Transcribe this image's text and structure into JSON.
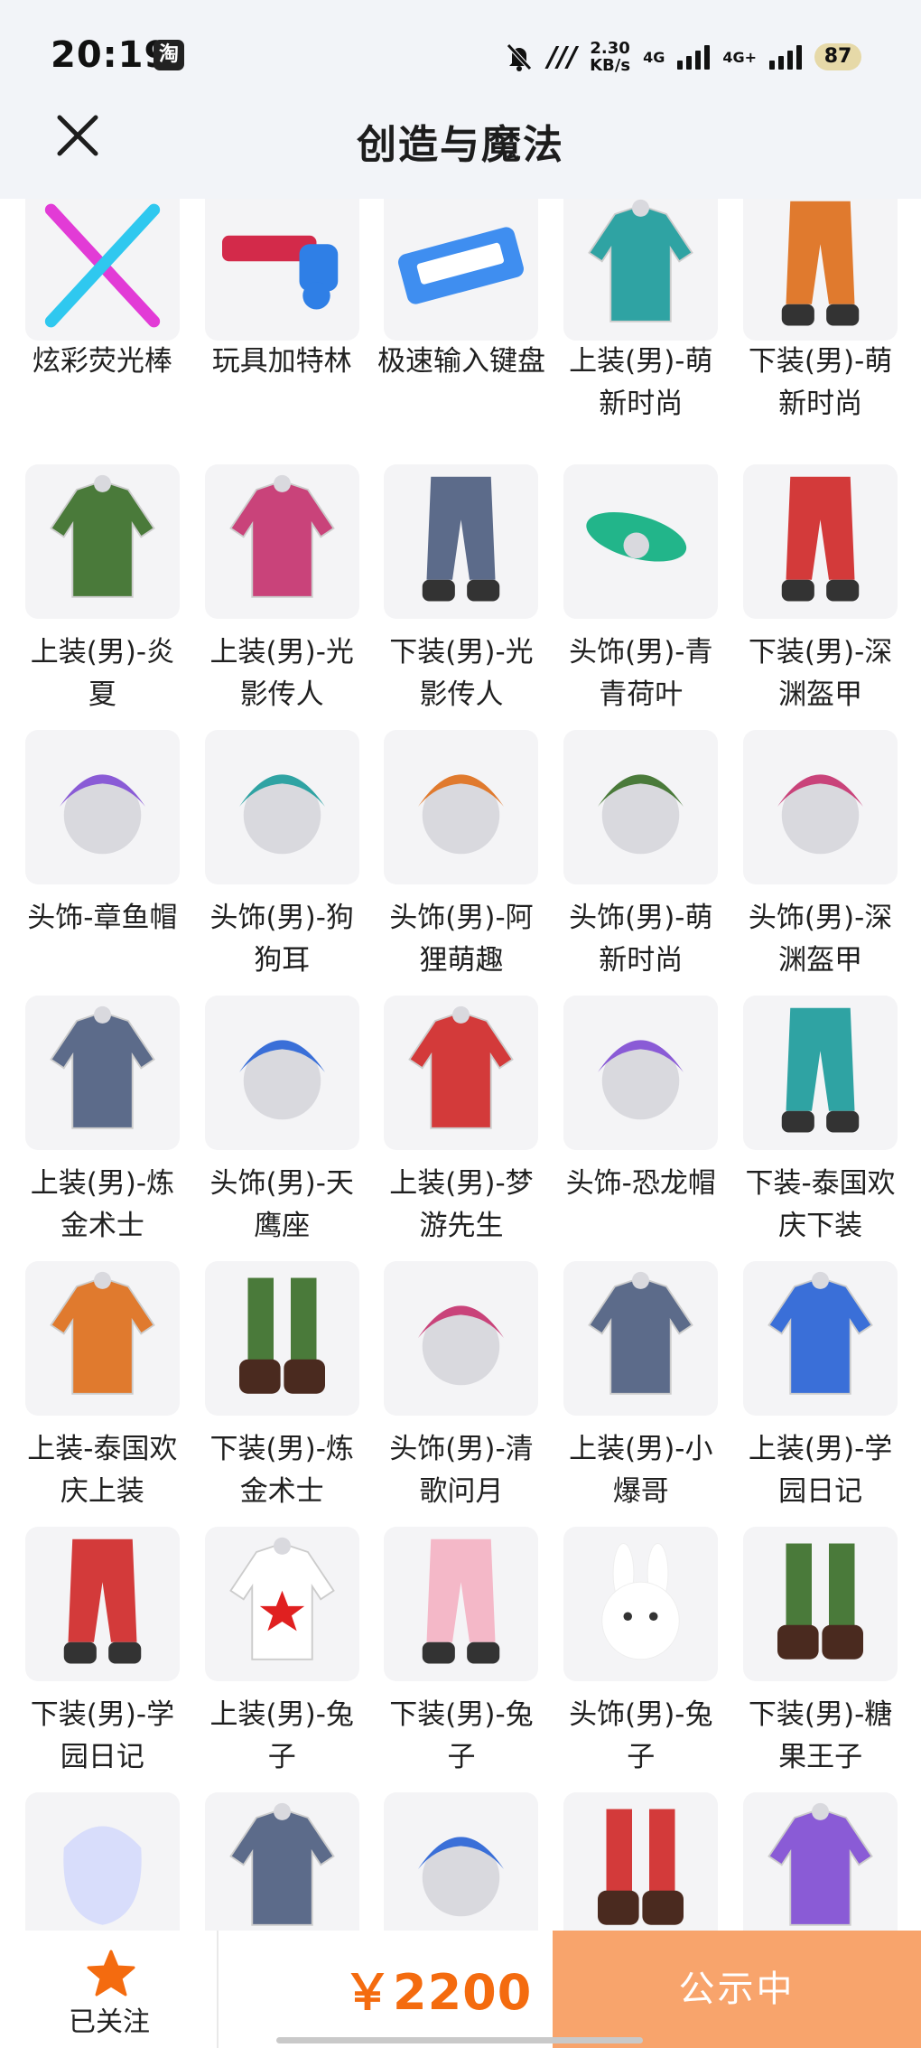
{
  "status_bar": {
    "time": "20:19",
    "app_badge": "淘",
    "speed_value": "2.30",
    "speed_unit": "KB/s",
    "net1": "4G",
    "net2": "4G+",
    "battery": "87"
  },
  "header": {
    "title": "创造与魔法"
  },
  "items": [
    {
      "label": "炫彩荧光棒",
      "icon": "glow-stick-icon"
    },
    {
      "label": "玩具加特林",
      "icon": "toy-gatling-icon"
    },
    {
      "label": "极速输入键盘",
      "icon": "keyboard-icon"
    },
    {
      "label": "上装(男)-萌新时尚",
      "icon": "top-icon"
    },
    {
      "label": "下装(男)-萌新时尚",
      "icon": "pants-icon"
    },
    {
      "label": "上装(男)-炎夏",
      "icon": "top-icon"
    },
    {
      "label": "上装(男)-光影传人",
      "icon": "jacket-icon"
    },
    {
      "label": "下装(男)-光影传人",
      "icon": "pants-icon"
    },
    {
      "label": "头饰(男)-青青荷叶",
      "icon": "leaf-hat-icon"
    },
    {
      "label": "下装(男)-深渊盔甲",
      "icon": "pants-icon"
    },
    {
      "label": "头饰-章鱼帽",
      "icon": "octopus-hat-icon"
    },
    {
      "label": "头饰(男)-狗狗耳",
      "icon": "dog-ears-icon"
    },
    {
      "label": "头饰(男)-阿狸萌趣",
      "icon": "fox-ears-icon"
    },
    {
      "label": "头饰(男)-萌新时尚",
      "icon": "hair-icon"
    },
    {
      "label": "头饰(男)-深渊盔甲",
      "icon": "helmet-icon"
    },
    {
      "label": "上装(男)-炼金术士",
      "icon": "robe-icon"
    },
    {
      "label": "头饰(男)-天鹰座",
      "icon": "astronaut-helmet-icon"
    },
    {
      "label": "上装(男)-梦游先生",
      "icon": "pajama-icon"
    },
    {
      "label": "头饰-恐龙帽",
      "icon": "dino-hat-icon"
    },
    {
      "label": "下装-泰国欢庆下装",
      "icon": "pants-icon"
    },
    {
      "label": "上装-泰国欢庆上装",
      "icon": "top-icon"
    },
    {
      "label": "下装(男)-炼金术士",
      "icon": "boots-icon"
    },
    {
      "label": "头饰(男)-清歌问月",
      "icon": "hair-icon"
    },
    {
      "label": "上装(男)-小爆哥",
      "icon": "hoodie-icon"
    },
    {
      "label": "上装(男)-学园日记",
      "icon": "jacket-icon"
    },
    {
      "label": "下装(男)-学园日记",
      "icon": "sneakers-icon"
    },
    {
      "label": "上装(男)-兔子",
      "icon": "star-suit-icon"
    },
    {
      "label": "下装(男)-兔子",
      "icon": "pink-legs-icon"
    },
    {
      "label": "头饰(男)-兔子",
      "icon": "bunny-hat-icon"
    },
    {
      "label": "下装(男)-糖果王子",
      "icon": "boots-icon"
    },
    {
      "label": "",
      "icon": "mask-icon"
    },
    {
      "label": "",
      "icon": "armor-icon"
    },
    {
      "label": "",
      "icon": "crown-head-icon"
    },
    {
      "label": "",
      "icon": "boots-icon"
    },
    {
      "label": "",
      "icon": "coat-icon"
    }
  ],
  "bottom_bar": {
    "follow_label": "已关注",
    "price": "￥2200",
    "cta_label": "公示中"
  },
  "colors": {
    "accent": "#f46b0f",
    "cta_bg": "#f8a46c",
    "header_bg": "#f2f4f8"
  }
}
